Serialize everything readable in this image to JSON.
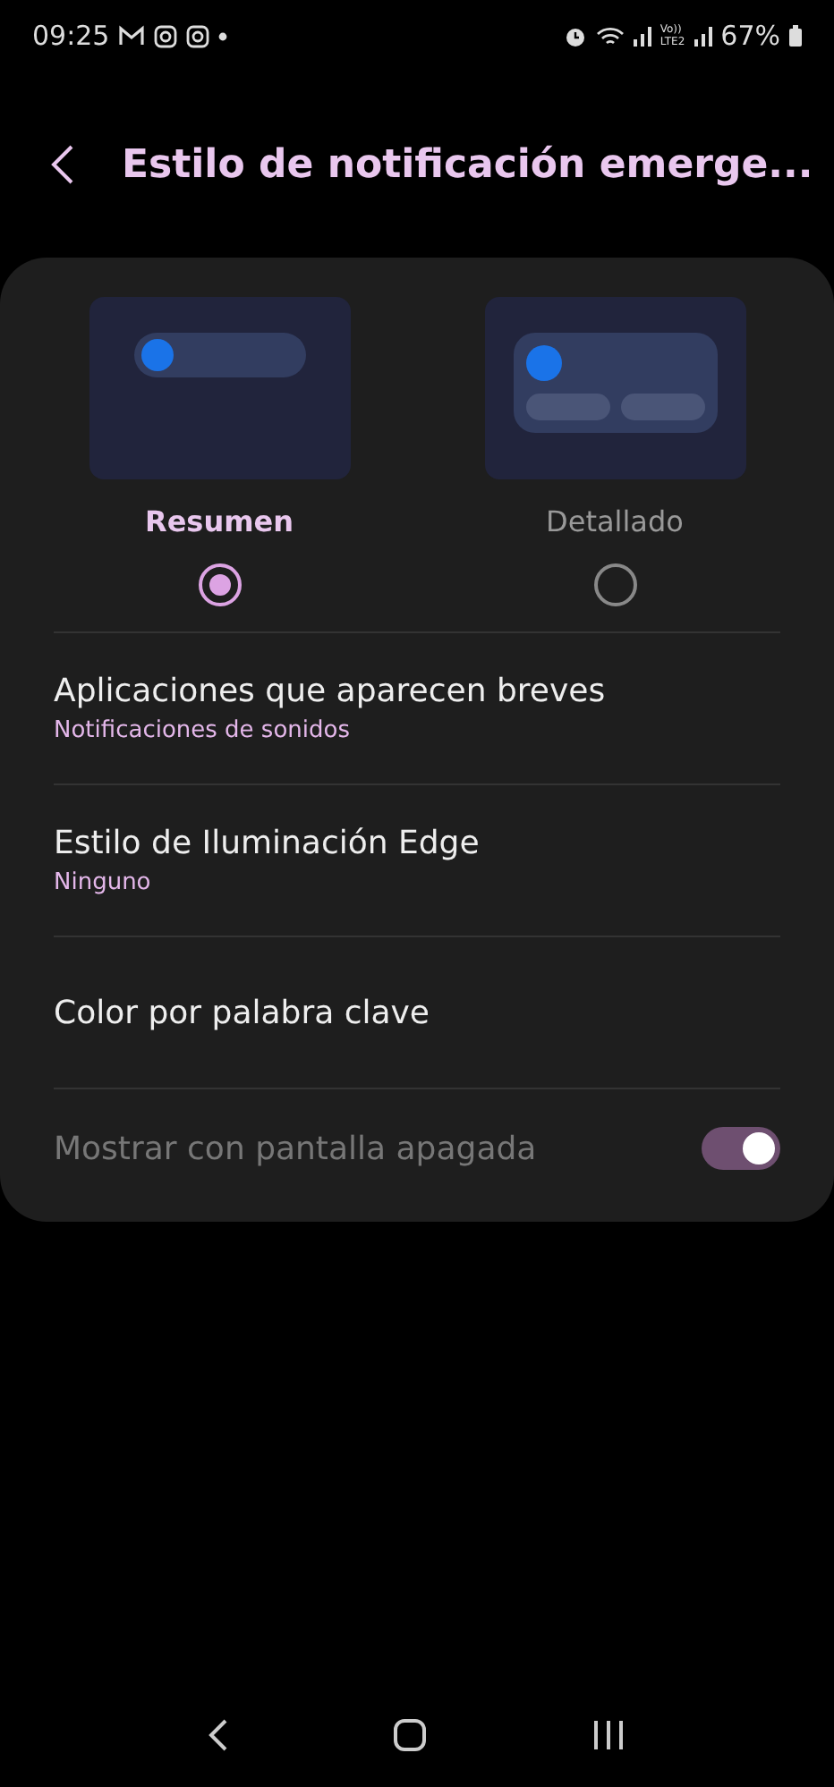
{
  "status_bar": {
    "time": "09:25",
    "volte_top": "Vo))",
    "volte_bottom": "LTE2",
    "battery": "67%"
  },
  "header": {
    "title": "Estilo de notificación emerge..."
  },
  "styles": [
    {
      "label": "Resumen",
      "kind": "brief",
      "selected": true
    },
    {
      "label": "Detallado",
      "kind": "detailed",
      "selected": false
    }
  ],
  "items": [
    {
      "kind": "link",
      "title": "Aplicaciones que aparecen breves",
      "subtitle": "Notificaciones de sonidos"
    },
    {
      "kind": "link",
      "title": "Estilo de Iluminación Edge",
      "subtitle": "Ninguno"
    },
    {
      "kind": "plain",
      "title": "Color por palabra clave"
    },
    {
      "kind": "toggle",
      "title": "Mostrar con pantalla apagada",
      "disabled": true,
      "on": true
    }
  ]
}
